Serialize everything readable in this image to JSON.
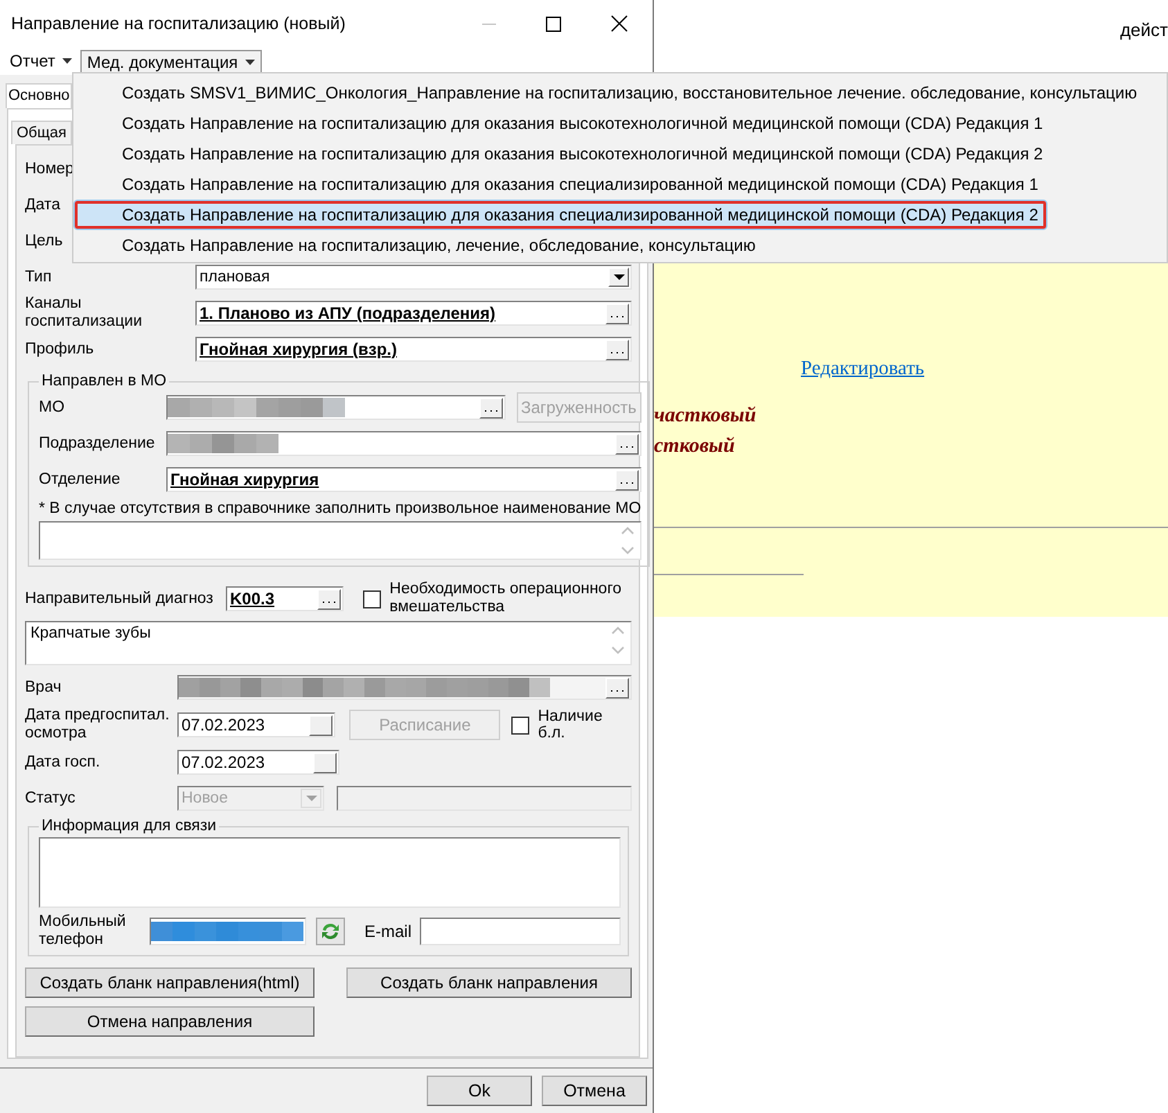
{
  "window": {
    "title": "Направление на госпитализацию (новый)"
  },
  "menu_bar": [
    {
      "label": "Отчет",
      "open": false
    },
    {
      "label": "Мед. документация",
      "open": true
    }
  ],
  "dropdown_menu": [
    {
      "label": "Создать SMSV1_ВИМИС_Онкология_Направление на госпитализацию, восстановительное лечение. обследование, консультацию",
      "selected": false
    },
    {
      "label": "Создать Направление на госпитализацию для оказания высокотехнологичной медицинской помощи (CDA) Редакция 1",
      "selected": false
    },
    {
      "label": "Создать Направление на госпитализацию для оказания высокотехнологичной медицинской помощи (CDA) Редакция 2",
      "selected": false
    },
    {
      "label": "Создать Направление на госпитализацию для оказания специализированной медицинской помощи (CDA) Редакция 1",
      "selected": false
    },
    {
      "label": "Создать Направление на госпитализацию для оказания специализированной медицинской помощи (CDA) Редакция 2",
      "selected": true
    },
    {
      "label": "Создать Направление на госпитализацию, лечение, обследование, консультацию",
      "selected": false
    }
  ],
  "tabs": [
    {
      "label": "Основно",
      "selected": true
    }
  ],
  "sub_tabs": [
    {
      "label": "Общая",
      "selected": true
    }
  ],
  "covered_rows": [
    {
      "label": "Номер"
    },
    {
      "label": "Дата"
    },
    {
      "label": "Цель"
    }
  ],
  "type": {
    "label": "Тип",
    "value": "плановая"
  },
  "channels": {
    "label": "Каналы госпитализации",
    "value": "1. Планово из АПУ (подразделения)"
  },
  "profile": {
    "label": "Профиль",
    "value": "Гнойная хирургия (взр.)"
  },
  "referred_to": {
    "title": "Направлен в МО",
    "mo_label": "МО",
    "load_button": {
      "label": "Загруженность",
      "disabled": true
    },
    "subdivision_label": "Подразделение",
    "department": {
      "label": "Отделение",
      "value": "Гнойная хирургия"
    },
    "note": "* В случае отсутствия в справочнике заполнить произвольное наименование МО"
  },
  "diagnosis": {
    "label": "Направительный диагноз",
    "code": "K00.3",
    "surgery_needed": {
      "label": "Необходимость  операционного вмешательства",
      "checked": false
    },
    "description": "Крапчатые зубы"
  },
  "doctor": {
    "label": "Врач"
  },
  "pre_exam_date": {
    "label": "Дата предгоспитал. осмотра",
    "value": "07.02.2023"
  },
  "schedule_button": {
    "label": "Расписание",
    "disabled": true
  },
  "sick_leave": {
    "label": "Наличие б.л.",
    "checked": false
  },
  "hosp_date": {
    "label": "Дата госп.",
    "value": "07.02.2023"
  },
  "status": {
    "label": "Статус",
    "value": "Новое",
    "disabled": true
  },
  "contact": {
    "title": "Информация для связи",
    "phone_label": "Мобильный телефон",
    "email_label": "E-mail"
  },
  "actions": [
    {
      "label": "Создать бланк направления(html)"
    },
    {
      "label": "Создать бланк направления"
    },
    {
      "label": "Отмена направления"
    }
  ],
  "footer_buttons": [
    {
      "label": "Ok"
    },
    {
      "label": "Отмена"
    }
  ],
  "background_page": {
    "header_text": "дейст",
    "link": "Редактировать",
    "lines": [
      "частковый",
      "стковый"
    ]
  }
}
